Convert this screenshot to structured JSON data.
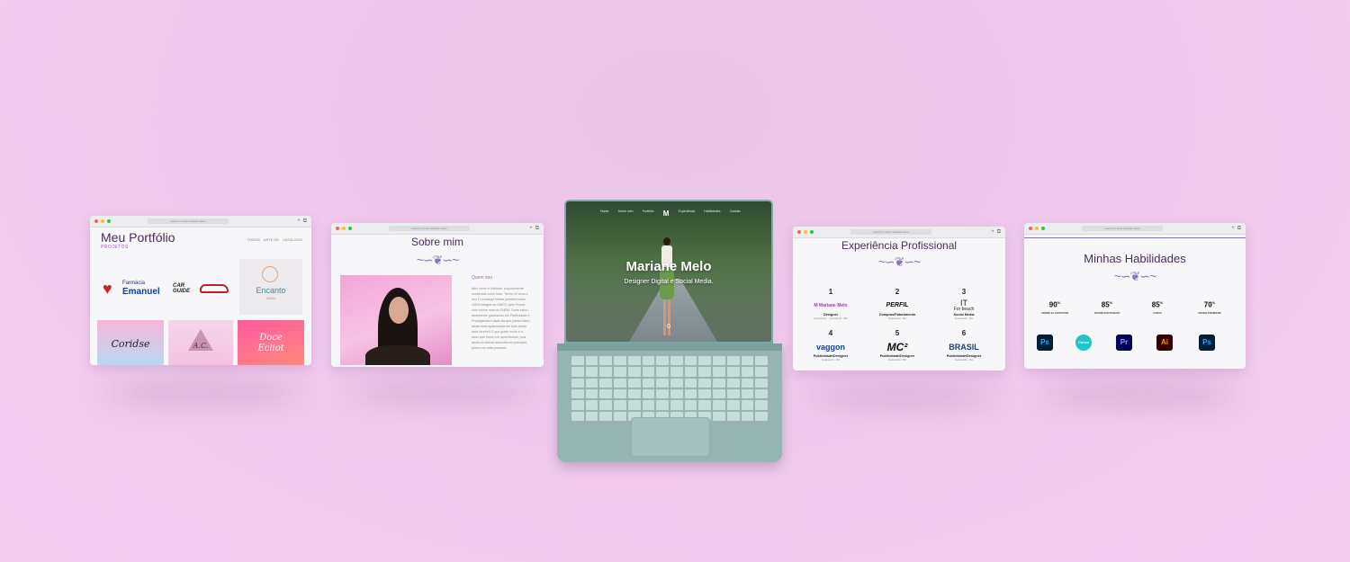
{
  "browser": {
    "url": "search or enter website name"
  },
  "portfolio": {
    "title": "Meu Portfólio",
    "subtitle": "PROJETOS",
    "nav": [
      "TODOS",
      "ARTE DE",
      "CATÁLOGO"
    ],
    "logos": {
      "farmacia_top": "Farmácia",
      "farmacia_bottom": "Emanuel",
      "car": "CAR GUIDE",
      "encanto": "Encanto",
      "encanto_sub": "Moda"
    },
    "tiles": {
      "t1": "Coridse",
      "t2": "A.C.",
      "t3": "Doce Ecliot"
    }
  },
  "about": {
    "title": "Sobre mim",
    "label": "Quem sou",
    "text": "Meu nome é Mariane, popularmente conhecida como Mari. Tenho 19 anos e sou TI consegui minha primeira bolsa 100% integral na UNIFG, pelo Prouni com minha nota do ENEM. Onde estou atualmente graduando em Publicidade e Propaganda e cada dia que passo estou ainda mais apaixonada em tudo desta área incrível! O que gosto muito é o ramo que estou em aprendizado, pois ainda só somos assuntos em princípio, posso me mais possível."
  },
  "laptop": {
    "nav": [
      "Home",
      "Sobre mim",
      "Portfólio",
      "Experiência",
      "Habilidades",
      "Contato"
    ],
    "name": "Mariane Melo",
    "role": "Designer Digital e Social Media.",
    "scroll": "0"
  },
  "experience": {
    "title": "Experiência Profissional",
    "items": [
      {
        "num": "1",
        "logo": "M Mariane Melo",
        "role": "Designer",
        "place": "Freelancer · Guanambi - BA"
      },
      {
        "num": "2",
        "logo": "PERFIL",
        "role": "Compras/Faturamento",
        "place": "Guanambi - BA"
      },
      {
        "num": "3",
        "logo": "IT",
        "logo_sub": "For beach",
        "role": "Social Media",
        "place": "Guanambi - BA"
      },
      {
        "num": "4",
        "logo": "vaggon",
        "role": "Publicidade/Designer",
        "place": "Guanambi - BA"
      },
      {
        "num": "5",
        "logo": "MC²",
        "role": "Publicidade/Designer",
        "place": "Guanambi - BA"
      },
      {
        "num": "6",
        "logo": "BRASIL",
        "role": "Publicidade/Designer",
        "place": "Guanambi - BA"
      }
    ]
  },
  "skills": {
    "title": "Minhas Habilidades",
    "pcts": [
      {
        "value": "90",
        "unit": "%",
        "name": "ADOBE ILLUSTRATOR"
      },
      {
        "value": "85",
        "unit": "%",
        "name": "ADOBE PHOTOSHOP"
      },
      {
        "value": "85",
        "unit": "%",
        "name": "CANVA"
      },
      {
        "value": "70",
        "unit": "%",
        "name": "ADOBE PREMIERE"
      }
    ],
    "icons": [
      {
        "label": "Ps",
        "color": "#31a8ff",
        "bg": "#001e36"
      },
      {
        "label": "Canva",
        "color": "#ffffff",
        "bg": "#20c4cb"
      },
      {
        "label": "Pr",
        "color": "#9999ff",
        "bg": "#00005b"
      },
      {
        "label": "Ai",
        "color": "#ff9a00",
        "bg": "#330000"
      },
      {
        "label": "Ps",
        "color": "#31a8ff",
        "bg": "#001e36"
      }
    ]
  }
}
